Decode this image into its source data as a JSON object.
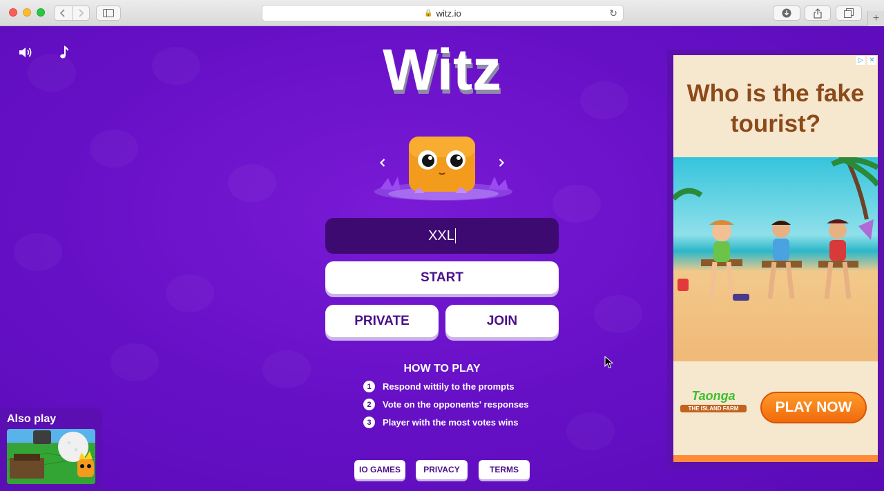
{
  "browser": {
    "url": "witz.io"
  },
  "game": {
    "logo": "Witz",
    "player_name": "XXL",
    "buttons": {
      "start": "START",
      "private": "PRIVATE",
      "join": "JOIN"
    },
    "how_to_play": {
      "title": "HOW TO PLAY",
      "steps": [
        {
          "num": "1",
          "text": "Respond wittily to the prompts"
        },
        {
          "num": "2",
          "text": "Vote on the opponents' responses"
        },
        {
          "num": "3",
          "text": "Player with the most votes wins"
        }
      ]
    },
    "footer": {
      "io_games": "IO GAMES",
      "privacy": "PRIVACY",
      "terms": "TERMS"
    },
    "also_play": {
      "title": "Also play"
    }
  },
  "ad": {
    "headline_line1": "Who is the fake",
    "headline_line2": "tourist?",
    "brand": "Taonga",
    "brand_sub": "THE ISLAND FARM",
    "cta": "PLAY NOW"
  },
  "colors": {
    "background": "#6a0fc8",
    "name_box": "#3d0a72",
    "button_text": "#4a0f8a",
    "ad_cta": "#f06a0c"
  },
  "icons": [
    "speaker-icon",
    "music-note-icon",
    "chevron-left-icon",
    "chevron-right-icon",
    "lock-icon",
    "reload-icon",
    "download-icon",
    "share-icon",
    "tabs-icon",
    "sidebar-icon",
    "ad-choices-icon",
    "ad-close-icon",
    "mouse-cursor-icon"
  ]
}
